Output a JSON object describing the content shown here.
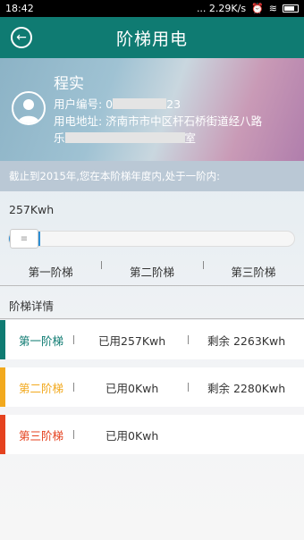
{
  "status_bar": {
    "time": "18:42",
    "net_speed": "... 2.29K/s"
  },
  "app_bar": {
    "title": "阶梯用电",
    "back_icon": "back-arrow-icon"
  },
  "profile": {
    "name": "程实",
    "user_no_label": "用户编号: 0",
    "user_no_tail": "23",
    "address_label": "用电地址: 济南市市中区杆石桥街道经八路",
    "address_line2_prefix": "乐",
    "address_line2_suffix": "室"
  },
  "notice": "截止到2015年,您在本阶梯年度内,处于一阶内:",
  "usage_text": "257Kwh",
  "usage_progress_fraction": 0.11,
  "tiers": [
    "第一阶梯",
    "第二阶梯",
    "第三阶梯"
  ],
  "detail_title": "阶梯详情",
  "details": [
    {
      "label": "第一阶梯",
      "used": "已用257Kwh",
      "remaining": "剩余 2263Kwh",
      "color": "#0f7b72"
    },
    {
      "label": "第二阶梯",
      "used": "已用0Kwh",
      "remaining": "剩余 2280Kwh",
      "color": "#f2a91e"
    },
    {
      "label": "第三阶梯",
      "used": "已用0Kwh",
      "remaining": "",
      "color": "#e5421f"
    }
  ]
}
